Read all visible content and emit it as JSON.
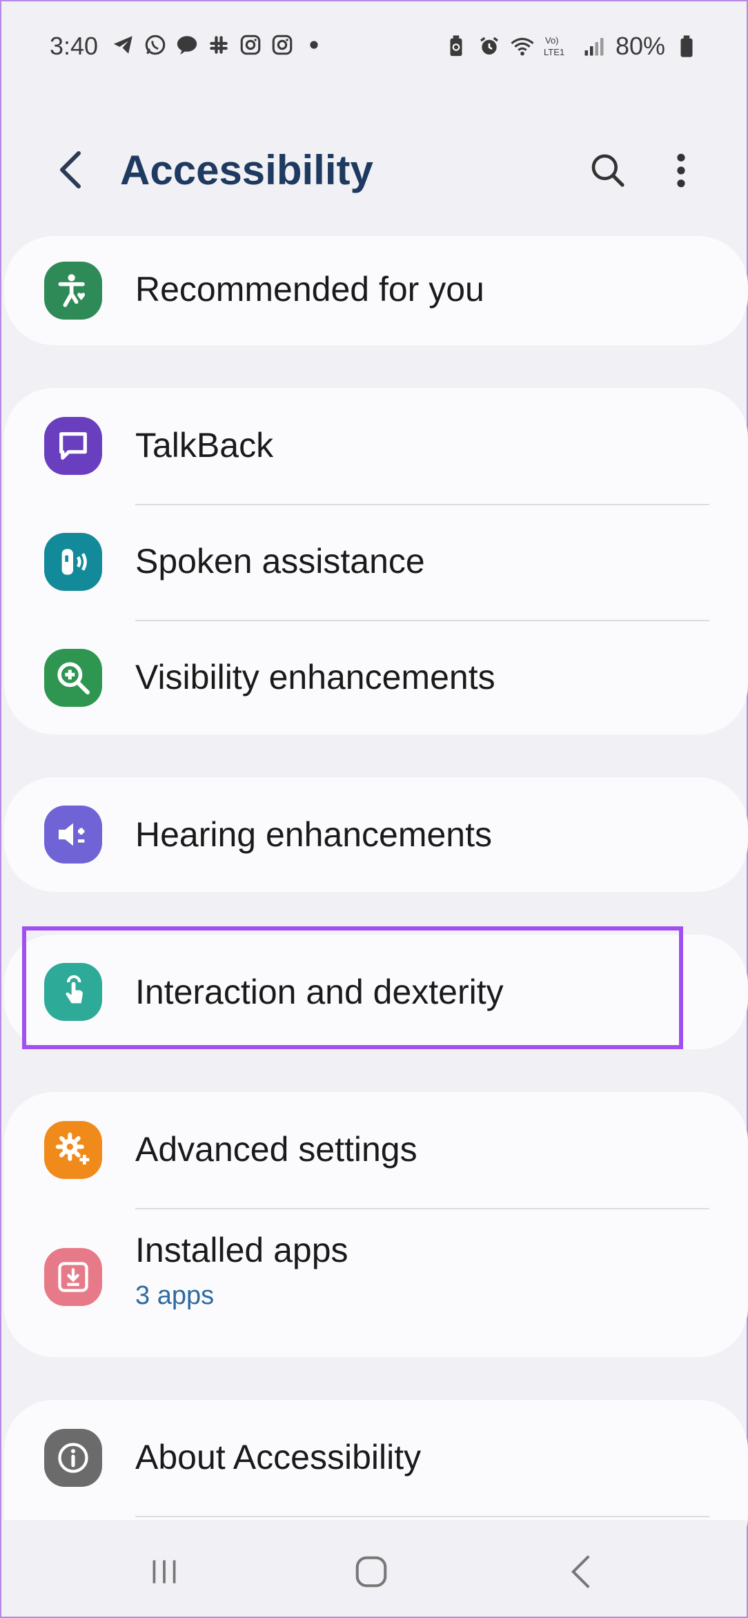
{
  "status_bar": {
    "time": "3:40",
    "battery_percent": "80%",
    "left_icons": [
      "telegram-icon",
      "whatsapp-icon",
      "chat-icon",
      "slack-icon",
      "instagram-icon",
      "instagram-icon",
      "dot-icon"
    ],
    "right_icons": [
      "battery-saver-icon",
      "alarm-icon",
      "wifi-icon",
      "volte-icon",
      "signal-icon",
      "battery-icon"
    ],
    "volte_text": "Vo) LTE1"
  },
  "header": {
    "title": "Accessibility"
  },
  "items": {
    "recommended": {
      "label": "Recommended for you",
      "icon": "accessibility-heart-icon",
      "color": "#2e8b57"
    },
    "talkback": {
      "label": "TalkBack",
      "icon": "talkback-icon",
      "color": "#6a3fbf"
    },
    "spoken": {
      "label": "Spoken assistance",
      "icon": "spoken-assistance-icon",
      "color": "#128a9a"
    },
    "visibility": {
      "label": "Visibility enhancements",
      "icon": "magnifier-icon",
      "color": "#2e9650"
    },
    "hearing": {
      "label": "Hearing enhancements",
      "icon": "hearing-icon",
      "color": "#6f63d6"
    },
    "interaction": {
      "label": "Interaction and dexterity",
      "icon": "touch-icon",
      "color": "#2eaa99"
    },
    "advanced": {
      "label": "Advanced settings",
      "icon": "gear-plus-icon",
      "color": "#f08a1a"
    },
    "installed": {
      "label": "Installed apps",
      "sub": "3 apps",
      "icon": "download-icon",
      "color": "#e77a88"
    },
    "about": {
      "label": "About Accessibility",
      "icon": "info-icon",
      "color": "#6b6b6b"
    }
  },
  "colors": {
    "highlight": "#a04ff0",
    "title": "#1f3a60",
    "background": "#f1f1f5",
    "card": "#fbfbfd"
  },
  "nav": [
    "recents-icon",
    "home-icon",
    "back-icon"
  ]
}
